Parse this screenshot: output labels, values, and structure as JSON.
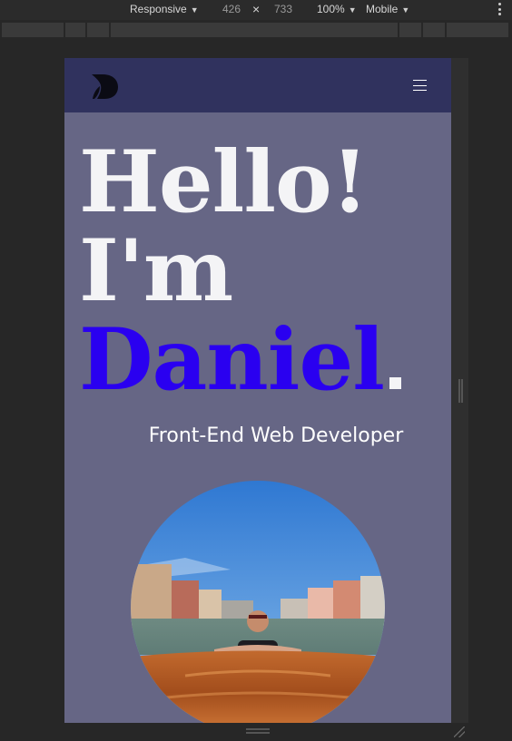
{
  "devtools": {
    "device_label": "Responsive",
    "width": "426",
    "times": "×",
    "height": "733",
    "zoom": "100%",
    "throttle": "Mobile"
  },
  "site": {
    "hero": {
      "line1": "Hello!",
      "line2": "I'm",
      "name": "Daniel",
      "name_color": "#2a00f0"
    },
    "subtitle": "Front-End Web Developer",
    "colors": {
      "nav_bg": "#30325e",
      "page_bg": "#666685",
      "heading": "#f4f4f6"
    },
    "icons": {
      "logo": "d-logo-icon",
      "menu": "hamburger-menu-icon"
    },
    "photo": "profile-photo-venice-boat"
  }
}
